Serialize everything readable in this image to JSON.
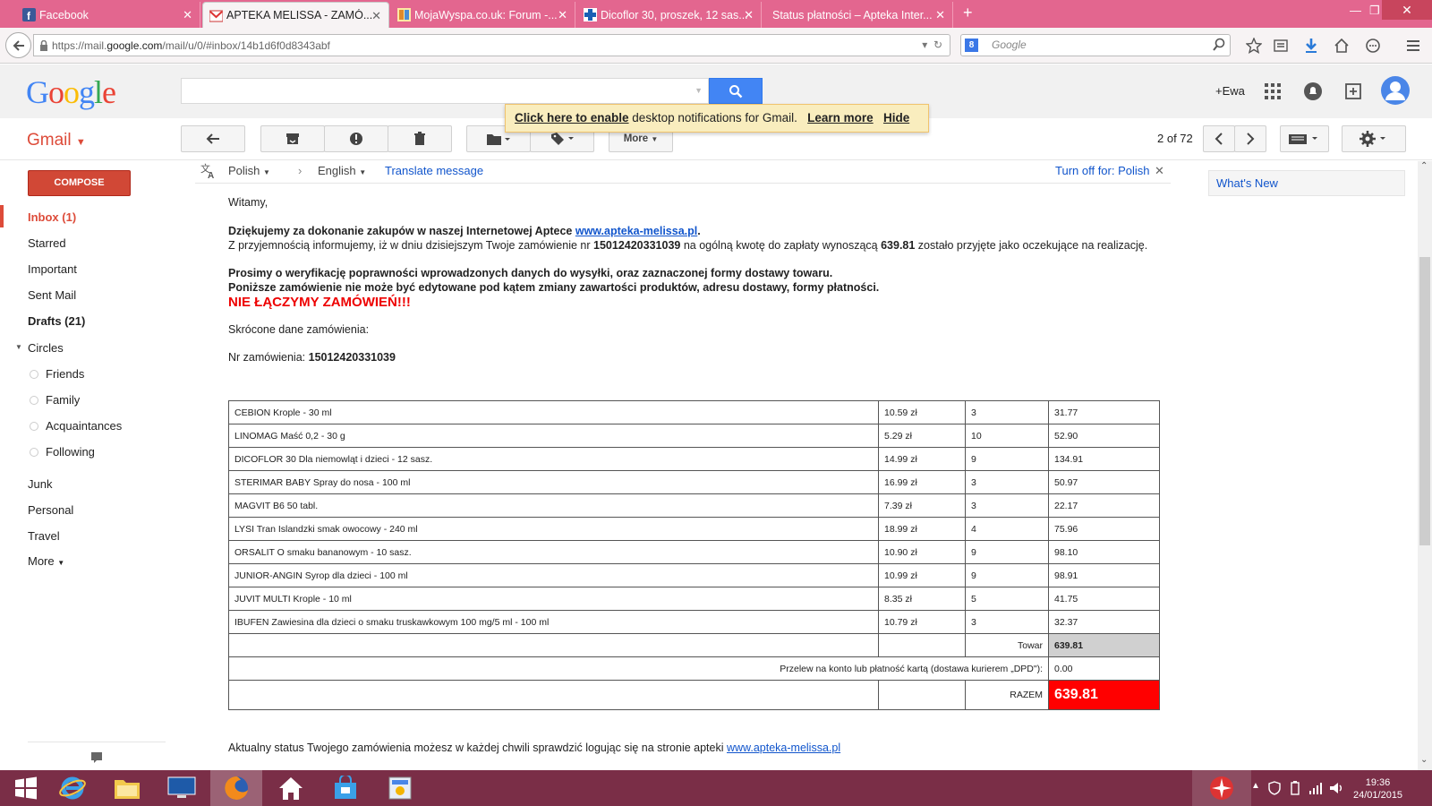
{
  "browser": {
    "tabs": [
      {
        "label": "Facebook"
      },
      {
        "label": "APTEKA MELISSA - ZAMÓ..."
      },
      {
        "label": "MojaWyspa.co.uk: Forum -..."
      },
      {
        "label": "Dicoflor 30, proszek, 12 sas..."
      },
      {
        "label": "Status płatności – Apteka Inter..."
      }
    ],
    "url_prefix": "https://mail.",
    "url_host": "google.com",
    "url_rest": "/mail/u/0/#inbox/14b1d6f0d8343abf",
    "search_placeholder": "Google"
  },
  "gmail": {
    "logo": "Google",
    "user_label": "+Ewa",
    "app_label": "Gmail",
    "notification": {
      "link": "Click here to enable",
      "text": " desktop notifications for Gmail.",
      "learn_more": "Learn more",
      "hide": "Hide"
    },
    "toolbar": {
      "more": "More",
      "pager": "2 of 72"
    },
    "compose": "COMPOSE",
    "nav": [
      {
        "label": "Inbox (1)"
      },
      {
        "label": "Starred"
      },
      {
        "label": "Important"
      },
      {
        "label": "Sent Mail"
      },
      {
        "label": "Drafts (21)"
      },
      {
        "label": "Circles"
      },
      {
        "label": "Friends"
      },
      {
        "label": "Family"
      },
      {
        "label": "Acquaintances"
      },
      {
        "label": "Following"
      },
      {
        "label": "Junk"
      },
      {
        "label": "Personal"
      },
      {
        "label": "Travel"
      },
      {
        "label": "More"
      }
    ],
    "translate": {
      "from": "Polish",
      "to": "English",
      "action": "Translate message",
      "turn_off": "Turn off for: Polish"
    },
    "whats_new": "What's New"
  },
  "message": {
    "greeting": "Witamy,",
    "thanks_prefix": "Dziękujemy za dokonanie zakupów w naszej Internetowej Aptece ",
    "thanks_link": "www.apteka-melissa.pl",
    "thanks_suffix": ".",
    "info_1": "Z przyjemnością informujemy, iż w dniu dzisiejszym Twoje zamówienie nr ",
    "order_number": "15012420331039",
    "info_2": " na ogólną kwotę do zapłaty wynoszącą ",
    "total_amount": "639.81",
    "info_3": " zostało przyjęte jako oczekujące na realizację.",
    "verify_1": "Prosimy o weryfikację poprawności wprowadzonych danych do wysyłki, oraz zaznaczonej formy dostawy towaru.",
    "verify_2": "Poniższe zamówienie nie może być edytowane pod kątem zmiany zawartości produktów, adresu dostawy, formy płatności.",
    "no_merge": "NIE ŁĄCZYMY ZAMÓWIEŃ!!!",
    "summary_label": "Skrócone dane zamówienia:",
    "order_label": "Nr zamówienia: ",
    "items": [
      {
        "name": "CEBION Krople - 30 ml",
        "price": "10.59 zł",
        "qty": "3",
        "total": "31.77"
      },
      {
        "name": "LINOMAG Maść 0,2 - 30 g",
        "price": "5.29 zł",
        "qty": "10",
        "total": "52.90"
      },
      {
        "name": "DICOFLOR 30 Dla niemowląt i dzieci - 12 sasz.",
        "price": "14.99 zł",
        "qty": "9",
        "total": "134.91"
      },
      {
        "name": "STERIMAR BABY Spray do nosa - 100 ml",
        "price": "16.99 zł",
        "qty": "3",
        "total": "50.97"
      },
      {
        "name": "MAGVIT B6 50 tabl.",
        "price": "7.39 zł",
        "qty": "3",
        "total": "22.17"
      },
      {
        "name": "LYSI Tran Islandzki smak owocowy - 240 ml",
        "price": "18.99 zł",
        "qty": "4",
        "total": "75.96"
      },
      {
        "name": "ORSALIT O smaku bananowym - 10 sasz.",
        "price": "10.90 zł",
        "qty": "9",
        "total": "98.10"
      },
      {
        "name": "JUNIOR-ANGIN Syrop dla dzieci - 100 ml",
        "price": "10.99 zł",
        "qty": "9",
        "total": "98.91"
      },
      {
        "name": "JUVIT MULTI Krople - 10 ml",
        "price": "8.35 zł",
        "qty": "5",
        "total": "41.75"
      },
      {
        "name": "IBUFEN Zawiesina dla dzieci o smaku truskawkowym 100 mg/5 ml - 100 ml",
        "price": "10.79 zł",
        "qty": "3",
        "total": "32.37"
      }
    ],
    "goods_label": "Towar",
    "goods_total": "639.81",
    "shipping_label": "Przelew na konto lub płatność kartą (dostawa kurierem „DPD\"):",
    "shipping_cost": "0.00",
    "sum_label": "RAZEM",
    "sum_total": "639.81",
    "status_text": "Aktualny status Twojego zamówienia możesz w każdej chwili sprawdzić logując się na stronie apteki ",
    "status_link": "www.apteka-melissa.pl"
  },
  "taskbar": {
    "time": "19:36",
    "date": "24/01/2015"
  },
  "colors": {
    "tabbar": "#e3668f",
    "taskbar": "#7a2e47",
    "gmail_red": "#dd4b39",
    "search_blue": "#4285f4"
  }
}
